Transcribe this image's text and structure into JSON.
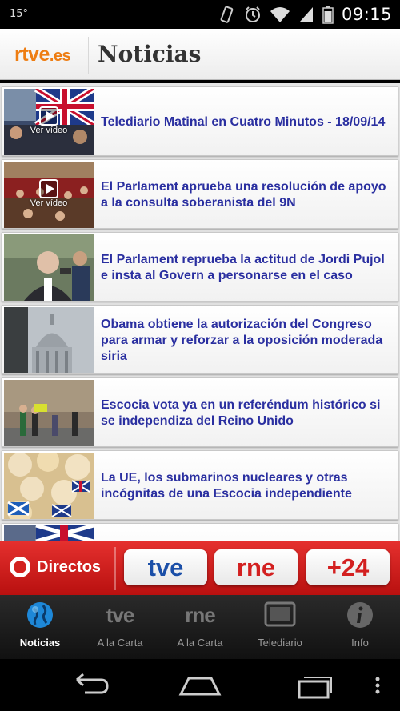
{
  "status_bar": {
    "left_text": "15°",
    "time": "09:15"
  },
  "header": {
    "logo_main": "rtve",
    "logo_suffix": ".es",
    "title": "Noticias"
  },
  "news": [
    {
      "title": "Telediario Matinal en Cuatro Minutos - 18/09/14",
      "video": true,
      "video_label": "Ver vídeo"
    },
    {
      "title": "El Parlament aprueba una resolución de apoyo a la consulta soberanista del 9N",
      "video": true,
      "video_label": "Ver vídeo"
    },
    {
      "title": "El Parlament reprueba la actitud de Jordi Pujol e insta al Govern a personarse en el caso",
      "video": false
    },
    {
      "title": "Obama obtiene la autorización del Congreso para armar y reforzar a la oposición moderada siria",
      "video": false
    },
    {
      "title": "Escocia vota ya en un referéndum histórico si se independiza del Reino Unido",
      "video": false
    },
    {
      "title": "La UE, los submarinos nucleares y otras incógnitas de una Escocia independiente",
      "video": false
    }
  ],
  "directos": {
    "label": "Directos",
    "channels": [
      "tve",
      "rne",
      "+24"
    ]
  },
  "tabs": [
    {
      "label": "Noticias",
      "icon": "globe-icon",
      "active": true
    },
    {
      "label": "A la Carta",
      "icon_text": "tve",
      "active": false
    },
    {
      "label": "A la Carta",
      "icon_text": "rne",
      "active": false
    },
    {
      "label": "Telediario",
      "icon": "tv-icon",
      "active": false
    },
    {
      "label": "Info",
      "icon": "info-icon",
      "active": false
    }
  ],
  "colors": {
    "brand_orange": "#ee7d12",
    "news_link": "#2a2fa0",
    "directos_red": "#d3221f"
  }
}
